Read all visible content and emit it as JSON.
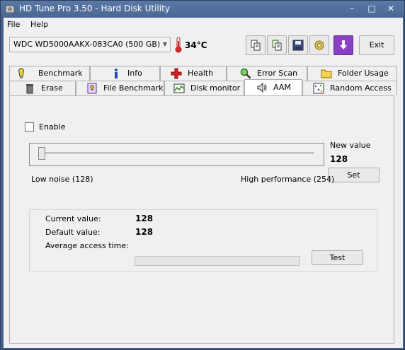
{
  "window": {
    "title": "HD Tune Pro 3.50 - Hard Disk Utility",
    "controls": {
      "minimize": "–",
      "maximize": "□",
      "close": "✕"
    }
  },
  "menu": {
    "file": "File",
    "help": "Help"
  },
  "drive": {
    "selected": "WDC WD5000AAKX-083CA0 (500 GB)",
    "temperature": "34°C"
  },
  "toolbar": {
    "exit_label": "Exit",
    "icons": [
      "copy-icon",
      "copy-all-icon",
      "save-icon",
      "options-icon",
      "download-icon"
    ]
  },
  "tabs_top": [
    {
      "label": "Benchmark",
      "icon": "benchmark-icon"
    },
    {
      "label": "Info",
      "icon": "info-icon"
    },
    {
      "label": "Health",
      "icon": "health-icon"
    },
    {
      "label": "Error Scan",
      "icon": "error-scan-icon"
    },
    {
      "label": "Folder Usage",
      "icon": "folder-icon"
    }
  ],
  "tabs_bottom": [
    {
      "label": "Erase",
      "icon": "trash-icon"
    },
    {
      "label": "File Benchmark",
      "icon": "file-benchmark-icon"
    },
    {
      "label": "Disk monitor",
      "icon": "disk-monitor-icon"
    },
    {
      "label": "AAM",
      "icon": "speaker-icon",
      "active": true
    },
    {
      "label": "Random Access",
      "icon": "random-access-icon"
    }
  ],
  "aam": {
    "enable_label": "Enable",
    "enabled": false,
    "new_value_label": "New value",
    "new_value": "128",
    "set_label": "Set",
    "slider_min_label": "Low noise (128)",
    "slider_max_label": "High performance (254)",
    "slider_value": 128,
    "slider_min": 128,
    "slider_max": 254,
    "current_value_label": "Current value:",
    "current_value": "128",
    "default_value_label": "Default value:",
    "default_value": "128",
    "avg_access_label": "Average access time:",
    "avg_access_value": "",
    "test_label": "Test",
    "test_progress": 0
  },
  "colors": {
    "title_bar": "#4a6792",
    "client_bg": "#f0f0f0",
    "temp_icon": "#d62c2c"
  }
}
